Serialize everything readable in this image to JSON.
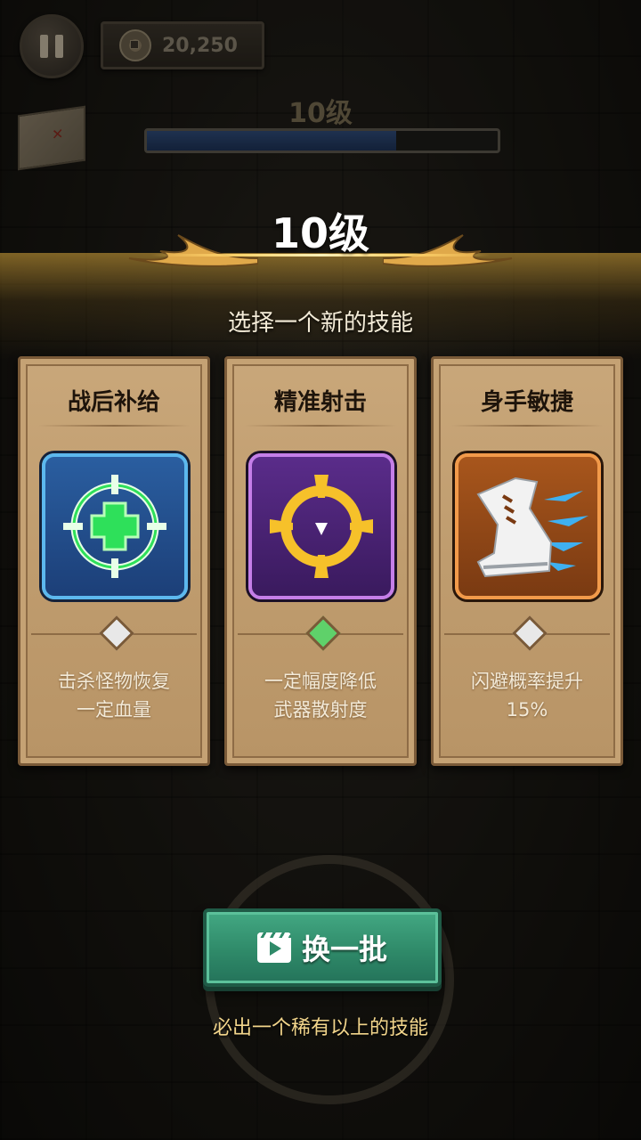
{
  "hud": {
    "coins": "20,250",
    "level_label": "10级",
    "xp_progress": 0.71
  },
  "levelup": {
    "title": "10级",
    "subtitle": "选择一个新的技能"
  },
  "cards": [
    {
      "name": "战后补给",
      "description_line1": "击杀怪物恢复",
      "description_line2": "一定血量",
      "icon": "heal-crosshair-icon",
      "rarity_color": "#e8e8e8"
    },
    {
      "name": "精准射击",
      "description_line1": "一定幅度降低",
      "description_line2": "武器散射度",
      "icon": "precision-crosshair-icon",
      "rarity_color": "#5fd16a"
    },
    {
      "name": "身手敏捷",
      "description_line1": "闪避概率提升",
      "description_line2": "15%",
      "icon": "swift-boot-icon",
      "rarity_color": "#e8e8e8"
    }
  ],
  "refresh": {
    "label": "换一批",
    "note": "必出一个稀有以上的技能"
  },
  "colors": {
    "card_parchment": "#c9a77a",
    "button_green": "#2f8a69",
    "gold_accent": "#ffd36b"
  }
}
